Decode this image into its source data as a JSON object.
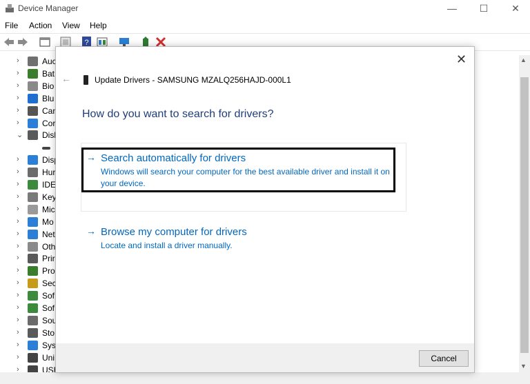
{
  "window": {
    "title": "Device Manager",
    "menu": [
      "File",
      "Action",
      "View",
      "Help"
    ],
    "controls": {
      "minimize": "—",
      "maximize": "☐",
      "close": "✕"
    }
  },
  "tree": {
    "items": [
      {
        "chev": "›",
        "label": "Auc",
        "color": "#707070"
      },
      {
        "chev": "›",
        "label": "Bat",
        "color": "#3a7d2c"
      },
      {
        "chev": "›",
        "label": "Bio",
        "color": "#8a8a8a"
      },
      {
        "chev": "›",
        "label": "Blu",
        "color": "#1f6fd1"
      },
      {
        "chev": "›",
        "label": "Can",
        "color": "#555555"
      },
      {
        "chev": "›",
        "label": "Cor",
        "color": "#2b7fd6"
      },
      {
        "chev": "⌄",
        "label": "Disl",
        "color": "#5a5a5a"
      },
      {
        "chev": "",
        "label": "",
        "color": "#444444"
      },
      {
        "chev": "›",
        "label": "Disp",
        "color": "#2b7fd6"
      },
      {
        "chev": "›",
        "label": "Hur",
        "color": "#6b6b6b"
      },
      {
        "chev": "›",
        "label": "IDE",
        "color": "#3c8a3c"
      },
      {
        "chev": "›",
        "label": "Key",
        "color": "#7a7a7a"
      },
      {
        "chev": "›",
        "label": "Mic",
        "color": "#9a9a9a"
      },
      {
        "chev": "›",
        "label": "Mo",
        "color": "#2b7fd6"
      },
      {
        "chev": "›",
        "label": "Net",
        "color": "#2b7fd6"
      },
      {
        "chev": "›",
        "label": "Oth",
        "color": "#8a8a8a"
      },
      {
        "chev": "›",
        "label": "Prir",
        "color": "#5a5a5a"
      },
      {
        "chev": "›",
        "label": "Pro",
        "color": "#3a7d2c"
      },
      {
        "chev": "›",
        "label": "Sec",
        "color": "#c89a1a"
      },
      {
        "chev": "›",
        "label": "Sof",
        "color": "#3c8a3c"
      },
      {
        "chev": "›",
        "label": "Sof",
        "color": "#3c8a3c"
      },
      {
        "chev": "›",
        "label": "Sou",
        "color": "#6b6b6b"
      },
      {
        "chev": "›",
        "label": "Sto",
        "color": "#5a5a5a"
      },
      {
        "chev": "›",
        "label": "Sys",
        "color": "#2b7fd6"
      },
      {
        "chev": "›",
        "label": "Uni",
        "color": "#444444"
      },
      {
        "chev": "›",
        "label": "USE",
        "color": "#444444"
      }
    ]
  },
  "dialog": {
    "title": "Update Drivers - SAMSUNG MZALQ256HAJD-000L1",
    "heading": "How do you want to search for drivers?",
    "close": "✕",
    "back": "←",
    "options": [
      {
        "arrow": "→",
        "title": "Search automatically for drivers",
        "desc_line1": "Windows will search your computer for the best available driver and install it on",
        "desc_line2": "your device."
      },
      {
        "arrow": "→",
        "title": "Browse my computer for drivers",
        "desc_line1": "Locate and install a driver manually."
      }
    ],
    "cancel": "Cancel"
  },
  "colors": {
    "link": "#0067c0",
    "heading": "#1f3d7a",
    "footer": "#f0f0f0"
  }
}
